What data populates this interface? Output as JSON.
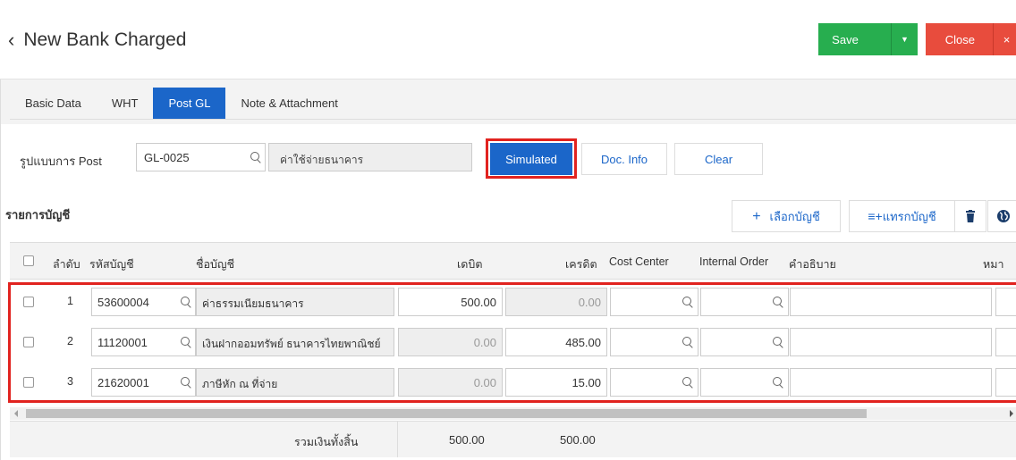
{
  "header": {
    "title": "New Bank Charged",
    "save_label": "Save",
    "close_label": "Close",
    "colors": {
      "save": "#27ae4f",
      "close": "#e84c3d",
      "primary": "#1b66c9"
    }
  },
  "tabs": [
    {
      "label": "Basic Data",
      "active": false
    },
    {
      "label": "WHT",
      "active": false
    },
    {
      "label": "Post GL",
      "active": true
    },
    {
      "label": "Note & Attachment",
      "active": false
    }
  ],
  "post_form": {
    "label": "รูปแบบการ Post",
    "code_value": "GL-0025",
    "name_value": "ค่าใช้จ่ายธนาคาร",
    "simulated_label": "Simulated",
    "doc_info_label": "Doc. Info",
    "clear_label": "Clear"
  },
  "accounts": {
    "title": "รายการบัญชี",
    "select_label": "เลือกบัญชี",
    "insert_label": "แทรกบัญชี",
    "columns": {
      "seq": "ลำดับ",
      "code": "รหัสบัญชี",
      "name": "ชื่อบัญชี",
      "debit": "เดบิต",
      "credit": "เครดิต",
      "cost_center": "Cost Center",
      "internal_order": "Internal Order",
      "description": "คำอธิบาย",
      "note": "หมา"
    },
    "rows": [
      {
        "seq": "1",
        "code": "53600004",
        "name": "ค่าธรรมเนียมธนาคาร",
        "debit": "500.00",
        "credit": "0.00"
      },
      {
        "seq": "2",
        "code": "11120001",
        "name": "เงินฝากออมทรัพย์ ธนาคารไทยพาณิชย์",
        "debit": "0.00",
        "credit": "485.00"
      },
      {
        "seq": "3",
        "code": "21620001",
        "name": "ภาษีหัก ณ ที่จ่าย",
        "debit": "0.00",
        "credit": "15.00"
      }
    ],
    "total_label": "รวมเงินทั้งสิ้น",
    "total_debit": "500.00",
    "total_credit": "500.00"
  }
}
